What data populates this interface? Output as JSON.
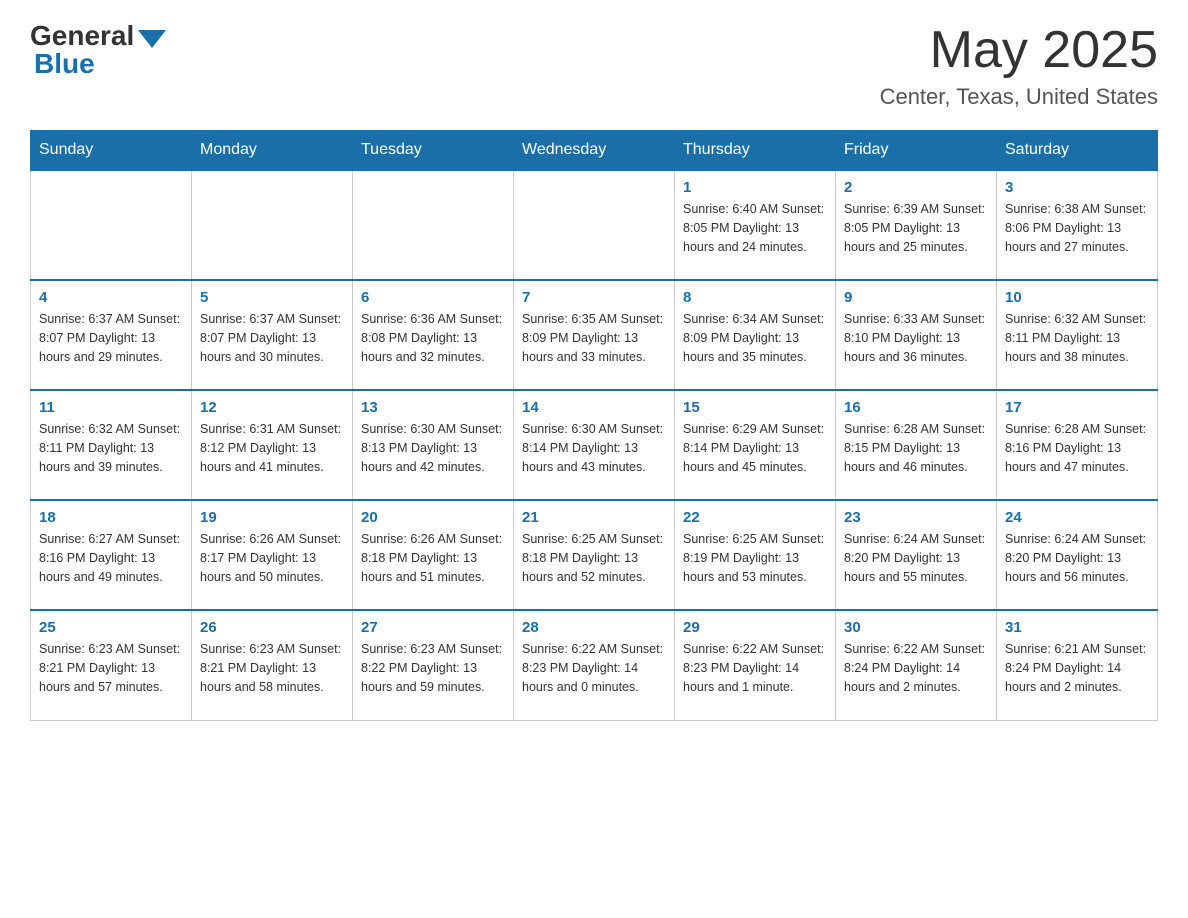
{
  "header": {
    "logo_general": "General",
    "logo_blue": "Blue",
    "month": "May 2025",
    "location": "Center, Texas, United States"
  },
  "days_of_week": [
    "Sunday",
    "Monday",
    "Tuesday",
    "Wednesday",
    "Thursday",
    "Friday",
    "Saturday"
  ],
  "weeks": [
    [
      {
        "day": "",
        "info": ""
      },
      {
        "day": "",
        "info": ""
      },
      {
        "day": "",
        "info": ""
      },
      {
        "day": "",
        "info": ""
      },
      {
        "day": "1",
        "info": "Sunrise: 6:40 AM\nSunset: 8:05 PM\nDaylight: 13 hours and 24 minutes."
      },
      {
        "day": "2",
        "info": "Sunrise: 6:39 AM\nSunset: 8:05 PM\nDaylight: 13 hours and 25 minutes."
      },
      {
        "day": "3",
        "info": "Sunrise: 6:38 AM\nSunset: 8:06 PM\nDaylight: 13 hours and 27 minutes."
      }
    ],
    [
      {
        "day": "4",
        "info": "Sunrise: 6:37 AM\nSunset: 8:07 PM\nDaylight: 13 hours and 29 minutes."
      },
      {
        "day": "5",
        "info": "Sunrise: 6:37 AM\nSunset: 8:07 PM\nDaylight: 13 hours and 30 minutes."
      },
      {
        "day": "6",
        "info": "Sunrise: 6:36 AM\nSunset: 8:08 PM\nDaylight: 13 hours and 32 minutes."
      },
      {
        "day": "7",
        "info": "Sunrise: 6:35 AM\nSunset: 8:09 PM\nDaylight: 13 hours and 33 minutes."
      },
      {
        "day": "8",
        "info": "Sunrise: 6:34 AM\nSunset: 8:09 PM\nDaylight: 13 hours and 35 minutes."
      },
      {
        "day": "9",
        "info": "Sunrise: 6:33 AM\nSunset: 8:10 PM\nDaylight: 13 hours and 36 minutes."
      },
      {
        "day": "10",
        "info": "Sunrise: 6:32 AM\nSunset: 8:11 PM\nDaylight: 13 hours and 38 minutes."
      }
    ],
    [
      {
        "day": "11",
        "info": "Sunrise: 6:32 AM\nSunset: 8:11 PM\nDaylight: 13 hours and 39 minutes."
      },
      {
        "day": "12",
        "info": "Sunrise: 6:31 AM\nSunset: 8:12 PM\nDaylight: 13 hours and 41 minutes."
      },
      {
        "day": "13",
        "info": "Sunrise: 6:30 AM\nSunset: 8:13 PM\nDaylight: 13 hours and 42 minutes."
      },
      {
        "day": "14",
        "info": "Sunrise: 6:30 AM\nSunset: 8:14 PM\nDaylight: 13 hours and 43 minutes."
      },
      {
        "day": "15",
        "info": "Sunrise: 6:29 AM\nSunset: 8:14 PM\nDaylight: 13 hours and 45 minutes."
      },
      {
        "day": "16",
        "info": "Sunrise: 6:28 AM\nSunset: 8:15 PM\nDaylight: 13 hours and 46 minutes."
      },
      {
        "day": "17",
        "info": "Sunrise: 6:28 AM\nSunset: 8:16 PM\nDaylight: 13 hours and 47 minutes."
      }
    ],
    [
      {
        "day": "18",
        "info": "Sunrise: 6:27 AM\nSunset: 8:16 PM\nDaylight: 13 hours and 49 minutes."
      },
      {
        "day": "19",
        "info": "Sunrise: 6:26 AM\nSunset: 8:17 PM\nDaylight: 13 hours and 50 minutes."
      },
      {
        "day": "20",
        "info": "Sunrise: 6:26 AM\nSunset: 8:18 PM\nDaylight: 13 hours and 51 minutes."
      },
      {
        "day": "21",
        "info": "Sunrise: 6:25 AM\nSunset: 8:18 PM\nDaylight: 13 hours and 52 minutes."
      },
      {
        "day": "22",
        "info": "Sunrise: 6:25 AM\nSunset: 8:19 PM\nDaylight: 13 hours and 53 minutes."
      },
      {
        "day": "23",
        "info": "Sunrise: 6:24 AM\nSunset: 8:20 PM\nDaylight: 13 hours and 55 minutes."
      },
      {
        "day": "24",
        "info": "Sunrise: 6:24 AM\nSunset: 8:20 PM\nDaylight: 13 hours and 56 minutes."
      }
    ],
    [
      {
        "day": "25",
        "info": "Sunrise: 6:23 AM\nSunset: 8:21 PM\nDaylight: 13 hours and 57 minutes."
      },
      {
        "day": "26",
        "info": "Sunrise: 6:23 AM\nSunset: 8:21 PM\nDaylight: 13 hours and 58 minutes."
      },
      {
        "day": "27",
        "info": "Sunrise: 6:23 AM\nSunset: 8:22 PM\nDaylight: 13 hours and 59 minutes."
      },
      {
        "day": "28",
        "info": "Sunrise: 6:22 AM\nSunset: 8:23 PM\nDaylight: 14 hours and 0 minutes."
      },
      {
        "day": "29",
        "info": "Sunrise: 6:22 AM\nSunset: 8:23 PM\nDaylight: 14 hours and 1 minute."
      },
      {
        "day": "30",
        "info": "Sunrise: 6:22 AM\nSunset: 8:24 PM\nDaylight: 14 hours and 2 minutes."
      },
      {
        "day": "31",
        "info": "Sunrise: 6:21 AM\nSunset: 8:24 PM\nDaylight: 14 hours and 2 minutes."
      }
    ]
  ]
}
